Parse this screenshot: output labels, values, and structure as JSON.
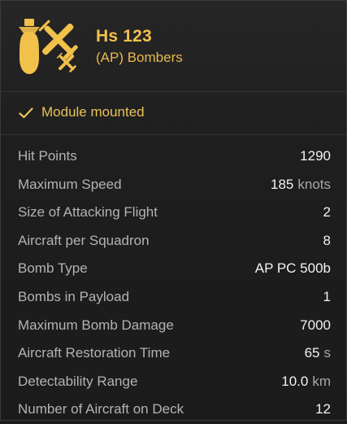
{
  "header": {
    "title": "Hs 123",
    "subtitle": "(AP) Bombers",
    "icon": "plane-bomber-icon",
    "accent": "#f2c14b"
  },
  "status": {
    "icon": "check-icon",
    "text": "Module mounted"
  },
  "stats": [
    {
      "label": "Hit Points",
      "value": "1290",
      "unit": ""
    },
    {
      "label": "Maximum Speed",
      "value": "185",
      "unit": "knots"
    },
    {
      "label": "Size of Attacking Flight",
      "value": "2",
      "unit": ""
    },
    {
      "label": "Aircraft per Squadron",
      "value": "8",
      "unit": ""
    },
    {
      "label": "Bomb Type",
      "value": "AP PC 500b",
      "unit": ""
    },
    {
      "label": "Bombs in Payload",
      "value": "1",
      "unit": ""
    },
    {
      "label": "Maximum Bomb Damage",
      "value": "7000",
      "unit": ""
    },
    {
      "label": "Aircraft Restoration Time",
      "value": "65",
      "unit": "s"
    },
    {
      "label": "Detectability Range",
      "value": "10.0",
      "unit": "km"
    },
    {
      "label": "Number of Aircraft on Deck",
      "value": "12",
      "unit": ""
    }
  ]
}
